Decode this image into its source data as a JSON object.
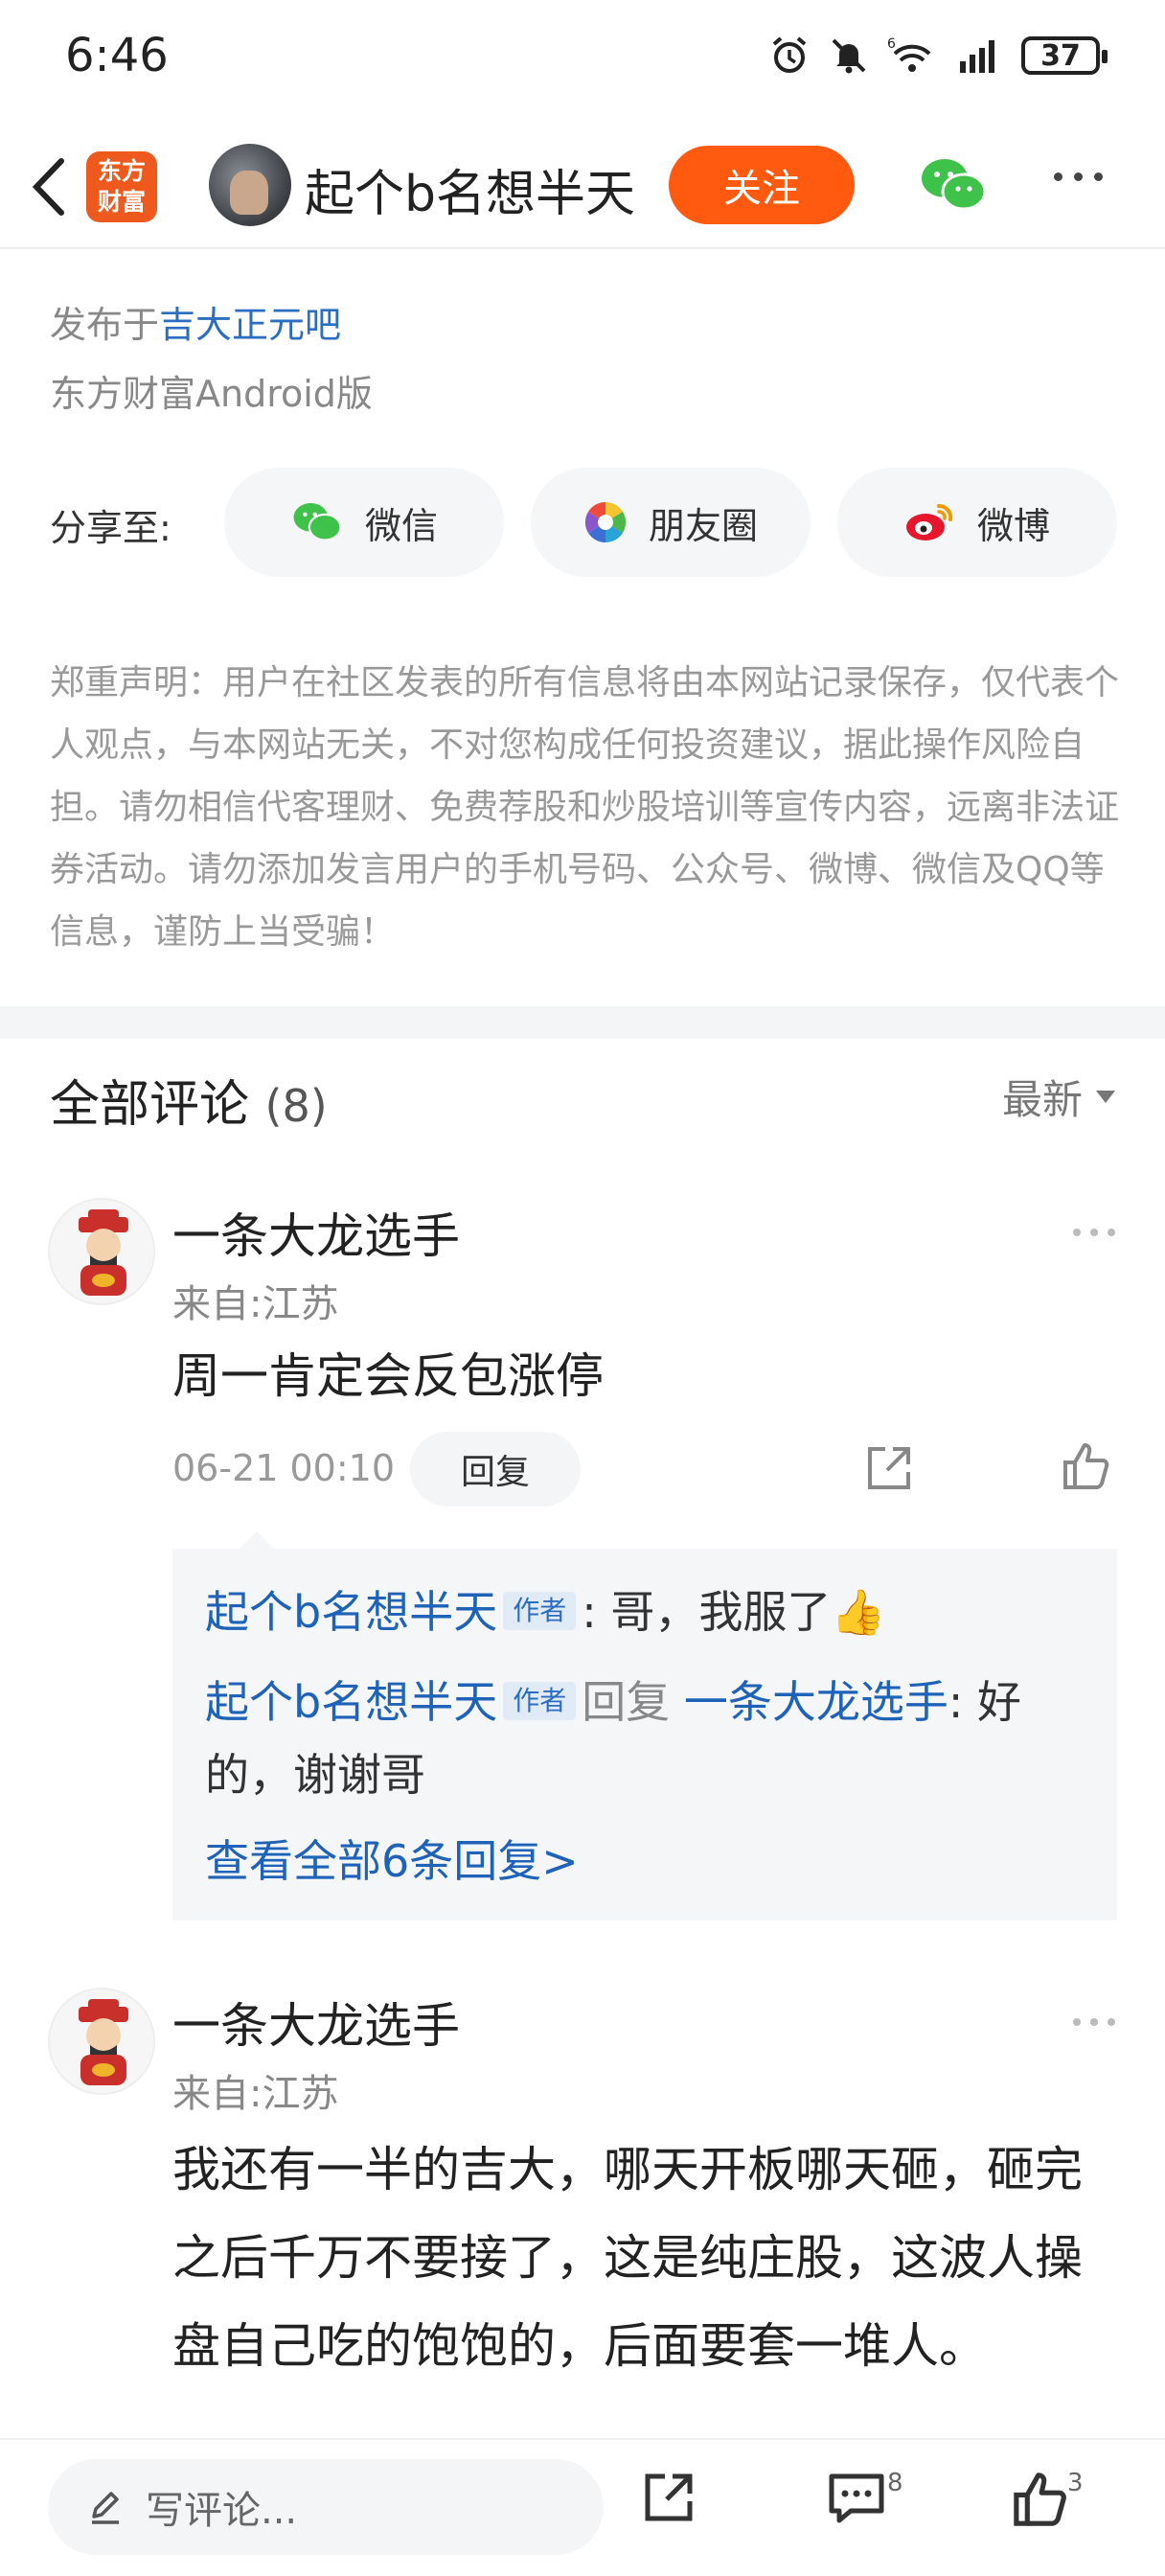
{
  "status_bar": {
    "time": "6:46",
    "battery": "37",
    "wifi_label": "6"
  },
  "header": {
    "app_logo_line1": "东方",
    "app_logo_line2": "财富",
    "author_name": "起个b名想半天",
    "follow_label": "关注"
  },
  "meta": {
    "published_prefix": "发布于",
    "forum_name": "吉大正元吧",
    "source": "东方财富Android版"
  },
  "share": {
    "label": "分享至:",
    "wechat": "微信",
    "moments": "朋友圈",
    "weibo": "微博"
  },
  "disclaimer": "郑重声明：用户在社区发表的所有信息将由本网站记录保存，仅代表个人观点，与本网站无关，不对您构成任何投资建议，据此操作风险自担。请勿相信代客理财、免费荐股和炒股培训等宣传内容，远离非法证券活动。请勿添加发言用户的手机号码、公众号、微博、微信及QQ等信息，谨防上当受骗！",
  "comments_header": {
    "title": "全部评论",
    "count": "(8)",
    "sort": "最新"
  },
  "comments": [
    {
      "user": "一条大龙选手",
      "location": "来自:江苏",
      "text": "周一肯定会反包涨停",
      "time": "06-21 00:10",
      "reply_label": "回复",
      "replies": [
        {
          "user": "起个b名想半天",
          "tag": "作者",
          "text": ": 哥，我服了👍"
        },
        {
          "user": "起个b名想半天",
          "tag": "作者",
          "reply_word": "回复",
          "target": "一条大龙选手",
          "text": ": 好的，谢谢哥"
        }
      ],
      "view_all": "查看全部6条回复>"
    },
    {
      "user": "一条大龙选手",
      "location": "来自:江苏",
      "text": "我还有一半的吉大，哪天开板哪天砸，砸完之后千万不要接了，这是纯庄股，这波人操盘自己吃的饱饱的，后面要套一堆人。"
    }
  ],
  "bottom_bar": {
    "write_placeholder": "写评论...",
    "comment_count": "8",
    "like_count": "3"
  },
  "colors": {
    "accent": "#ff5a10",
    "link": "#1e63b8",
    "logo": "#ee5a1e"
  }
}
